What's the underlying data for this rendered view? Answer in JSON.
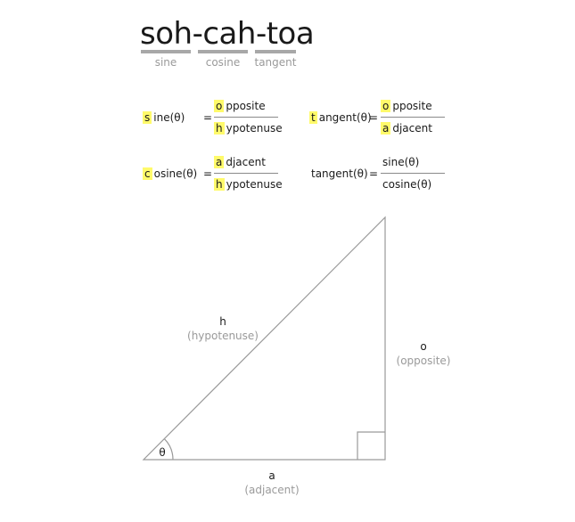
{
  "title": {
    "sine_part": "soh",
    "dash1": "-",
    "cosine_part": "cah",
    "dash2": "-",
    "tangent_part": "toa",
    "captions": {
      "sine": "sine",
      "cosine": "cosine",
      "tangent": "tangent"
    }
  },
  "formulas": {
    "sine": {
      "lhs_highlight": "s",
      "lhs_rest": "ine(θ)",
      "equals": "=",
      "num_highlight": "o",
      "num_rest": "pposite",
      "den_highlight": "h",
      "den_rest": "ypotenuse"
    },
    "cosine": {
      "lhs_highlight": "c",
      "lhs_rest": "osine(θ)",
      "equals": "=",
      "num_highlight": "a",
      "num_rest": "djacent",
      "den_highlight": "h",
      "den_rest": "ypotenuse"
    },
    "tangent": {
      "lhs_highlight": "t",
      "lhs_rest": "angent(θ)",
      "equals": "=",
      "num_highlight": "o",
      "num_rest": "pposite",
      "den_highlight": "a",
      "den_rest": "djacent"
    },
    "tangent_ratio": {
      "lhs": "tangent(θ)",
      "equals": "=",
      "num": "sine(θ)",
      "den": "cosine(θ)"
    }
  },
  "triangle": {
    "angle": "θ",
    "hypotenuse": {
      "label": "h",
      "sub": "(hypotenuse)"
    },
    "opposite": {
      "label": "o",
      "sub": "(opposite)"
    },
    "adjacent": {
      "label": "a",
      "sub": "(adjacent)"
    }
  },
  "colors": {
    "highlight": "#fffa6b",
    "rule": "#a8a8a8",
    "muted_text": "#9a9a9a",
    "stroke": "#9a9a9a"
  }
}
